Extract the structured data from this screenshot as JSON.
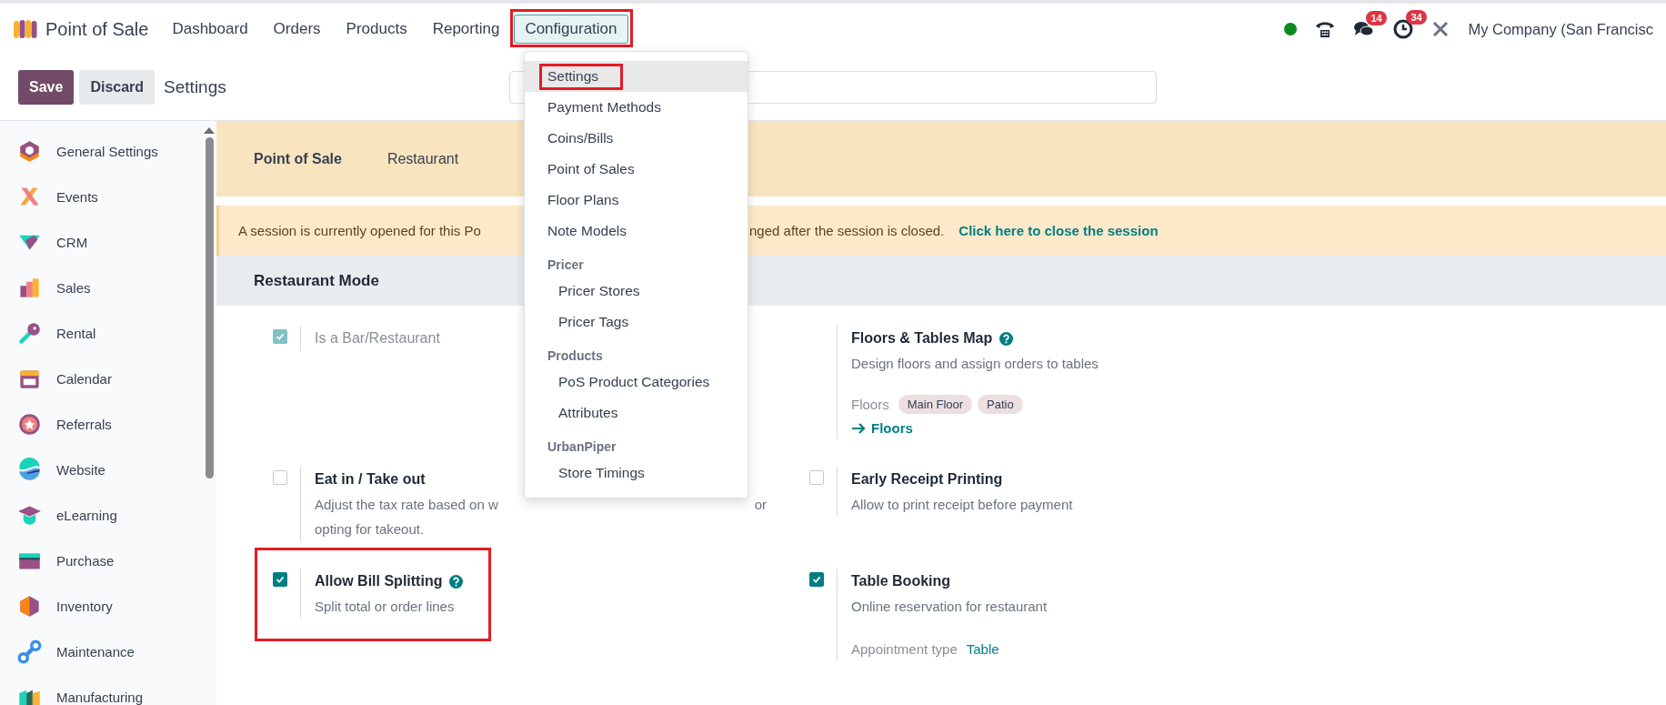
{
  "app": {
    "title": "Point of Sale"
  },
  "menu": [
    {
      "label": "Dashboard",
      "selected": false,
      "highlighted": false
    },
    {
      "label": "Orders",
      "selected": false,
      "highlighted": false
    },
    {
      "label": "Products",
      "selected": false,
      "highlighted": false
    },
    {
      "label": "Reporting",
      "selected": false,
      "highlighted": false
    },
    {
      "label": "Configuration",
      "selected": true,
      "highlighted": true
    }
  ],
  "systray": {
    "messages_count": "14",
    "activities_count": "34",
    "company": "My Company (San Francisc"
  },
  "control_panel": {
    "save": "Save",
    "discard": "Discard",
    "breadcrumb": "Settings"
  },
  "sidebar": {
    "items": [
      {
        "label": "General Settings"
      },
      {
        "label": "Events"
      },
      {
        "label": "CRM"
      },
      {
        "label": "Sales"
      },
      {
        "label": "Rental"
      },
      {
        "label": "Calendar"
      },
      {
        "label": "Referrals"
      },
      {
        "label": "Website"
      },
      {
        "label": "eLearning"
      },
      {
        "label": "Purchase"
      },
      {
        "label": "Inventory"
      },
      {
        "label": "Maintenance"
      },
      {
        "label": "Manufacturing"
      }
    ]
  },
  "settings_tabs": [
    {
      "label": "Point of Sale",
      "selected": true
    },
    {
      "label": "Restaurant",
      "selected": false
    }
  ],
  "notice": {
    "text_start": "A session is currently opened for this Po",
    "text_end": "nged after the session is closed.",
    "link": "Click here to close the session"
  },
  "section": {
    "title": "Restaurant Mode",
    "settings": [
      {
        "kind": "checkbox",
        "title": "Is a Bar/Restaurant",
        "checked": true,
        "disabled": true,
        "help": false,
        "highlighted": false
      },
      {
        "kind": "floors",
        "title": "Floors & Tables Map",
        "help": true,
        "highlighted": false,
        "description": "Design floors and assign orders to tables",
        "floors_label": "Floors",
        "tags": [
          "Main Floor",
          "Patio"
        ],
        "link": "Floors"
      },
      {
        "kind": "checkbox",
        "title": "Eat in / Take out",
        "checked": false,
        "disabled": false,
        "help": false,
        "highlighted": false,
        "description": "Adjust the tax rate based on w",
        "description_end": "or",
        "description_line2": "opting for takeout."
      },
      {
        "kind": "checkbox",
        "title": "Early Receipt Printing",
        "checked": false,
        "disabled": false,
        "help": false,
        "highlighted": false,
        "description": "Allow to print receipt before payment"
      },
      {
        "kind": "checkbox",
        "title": "Allow Bill Splitting",
        "checked": true,
        "disabled": false,
        "help": true,
        "highlighted": true,
        "description": "Split total or order lines"
      },
      {
        "kind": "checkbox",
        "title": "Table Booking",
        "checked": true,
        "disabled": false,
        "help": false,
        "highlighted": false,
        "description": "Online reservation for restaurant",
        "field_label": "Appointment type",
        "field_value": "Table"
      }
    ]
  },
  "dropdown": {
    "items": [
      {
        "kind": "item",
        "label": "Settings",
        "selected": true,
        "highlighted": true
      },
      {
        "kind": "item",
        "label": "Payment Methods",
        "selected": false,
        "highlighted": false
      },
      {
        "kind": "item",
        "label": "Coins/Bills",
        "selected": false,
        "highlighted": false
      },
      {
        "kind": "item",
        "label": "Point of Sales",
        "selected": false,
        "highlighted": false
      },
      {
        "kind": "item",
        "label": "Floor Plans",
        "selected": false,
        "highlighted": false
      },
      {
        "kind": "item",
        "label": "Note Models",
        "selected": false,
        "highlighted": false
      },
      {
        "kind": "header",
        "label": "Pricer"
      },
      {
        "kind": "subitem",
        "label": "Pricer Stores",
        "selected": false,
        "highlighted": false
      },
      {
        "kind": "subitem",
        "label": "Pricer Tags",
        "selected": false,
        "highlighted": false
      },
      {
        "kind": "header",
        "label": "Products"
      },
      {
        "kind": "subitem",
        "label": "PoS Product Categories",
        "selected": false,
        "highlighted": false
      },
      {
        "kind": "subitem",
        "label": "Attributes",
        "selected": false,
        "highlighted": false
      },
      {
        "kind": "header",
        "label": "UrbanPiper"
      },
      {
        "kind": "subitem",
        "label": "Store Timings",
        "selected": false,
        "highlighted": false
      }
    ]
  }
}
